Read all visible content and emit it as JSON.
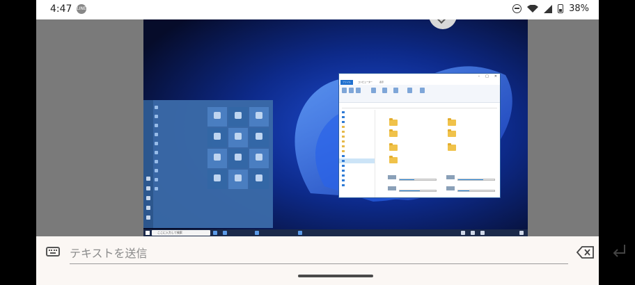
{
  "status_bar": {
    "time": "4:47",
    "notification_icon": "line-notification-icon",
    "battery_percent": "38%",
    "icons": [
      "do-not-disturb-icon",
      "wifi-icon",
      "signal-icon",
      "battery-icon"
    ]
  },
  "remote": {
    "start_menu": {
      "apps": [
        "",
        "",
        "",
        "",
        "",
        "",
        "",
        "",
        "",
        ""
      ]
    },
    "taskbar": {
      "search_placeholder": "ここに入力して検索"
    },
    "explorer": {
      "tabs": [
        "ファイル",
        "コンピューター",
        "表示"
      ]
    }
  },
  "input": {
    "placeholder": "テキストを送信"
  },
  "colors": {
    "accent": "#1e6fce",
    "start_menu": "#3a6aa8",
    "input_bar": "#fbf7f4"
  }
}
